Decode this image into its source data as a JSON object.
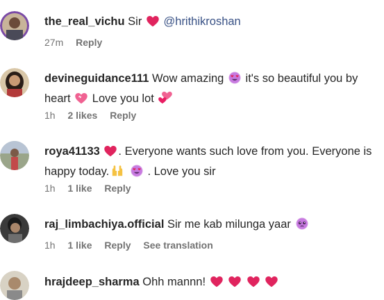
{
  "comments": [
    {
      "username": "the_real_vichu",
      "text_before": "Sir",
      "mention": "@hrithikroshan",
      "time": "27m",
      "reply": "Reply"
    },
    {
      "username": "devineguidance111",
      "text_a": "Wow amazing",
      "text_b": "it's so beautiful you by heart",
      "text_c": "Love you lot",
      "time": "1h",
      "likes": "2 likes",
      "reply": "Reply"
    },
    {
      "username": "roya41133",
      "text_a": ". Everyone wants such love from you. Everyone is happy today.",
      "text_b": ". Love you sir",
      "time": "1h",
      "likes": "1 like",
      "reply": "Reply"
    },
    {
      "username": "raj_limbachiya.official",
      "text_a": "Sir me kab milunga yaar",
      "time": "1h",
      "likes": "1 like",
      "reply": "Reply",
      "translation": "See translation"
    },
    {
      "username": "hrajdeep_sharma",
      "text_a": "Ohh mannn!"
    }
  ]
}
